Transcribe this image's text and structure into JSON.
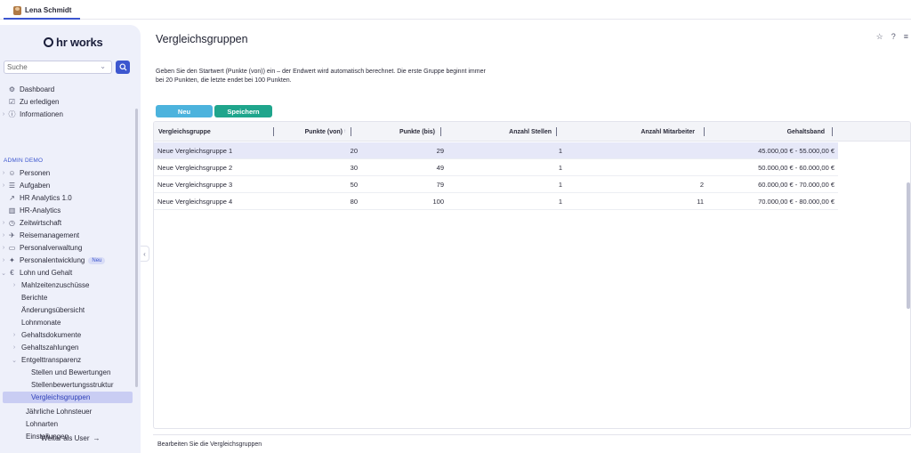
{
  "user": {
    "name": "Lena Schmidt"
  },
  "logo": {
    "text": "hr works"
  },
  "search": {
    "placeholder": "Suche"
  },
  "sidebar": {
    "top_items": [
      {
        "label": "Dashboard",
        "icon": "dashboard-icon"
      },
      {
        "label": "Zu erledigen",
        "icon": "todo-icon"
      },
      {
        "label": "Informationen",
        "icon": "info-icon"
      }
    ],
    "section_label": "ADMIN DEMO",
    "admin_items": [
      {
        "label": "Personen",
        "icon": "people-icon"
      },
      {
        "label": "Aufgaben",
        "icon": "tasks-icon"
      },
      {
        "label": "HR Analytics 1.0",
        "icon": "analytics-icon"
      },
      {
        "label": "HR-Analytics",
        "icon": "bar-chart-icon"
      },
      {
        "label": "Zeitwirtschaft",
        "icon": "clock-icon"
      },
      {
        "label": "Reisemanagement",
        "icon": "travel-icon"
      },
      {
        "label": "Personalverwaltung",
        "icon": "folder-icon"
      },
      {
        "label": "Personalentwicklung",
        "icon": "development-icon",
        "badge": "Neu"
      },
      {
        "label": "Lohn und Gehalt",
        "icon": "payroll-icon"
      }
    ],
    "payroll_items": [
      "Mahlzeitenzuschüsse",
      "Berichte",
      "Änderungsübersicht",
      "Lohnmonate",
      "Gehaltsdokumente",
      "Gehaltszahlungen",
      "Entgelttransparenz"
    ],
    "transparency_items": [
      "Stellen und Bewertungen",
      "Stellenbewertungsstruktur",
      "Vergleichsgruppen"
    ],
    "trailing_items": [
      "Jährliche Lohnsteuer",
      "Lohnarten",
      "Einstellungen"
    ],
    "weiter_label": "Weiter als User"
  },
  "page": {
    "title": "Vergleichsgruppen",
    "intro_line1": "Geben Sie den Startwert (Punkte (von)) ein – der Endwert wird automatisch berechnet. Die erste Gruppe beginnt immer",
    "intro_line2": "bei 20 Punkten, die letzte endet bei 100 Punkten.",
    "btn_new": "Neu",
    "btn_save": "Speichern",
    "footer": "Bearbeiten Sie die Vergleichsgruppen"
  },
  "table": {
    "headers": {
      "group": "Vergleichsgruppe",
      "from": "Punkte (von)",
      "to": "Punkte (bis)",
      "positions": "Anzahl Stellen",
      "employees": "Anzahl Mitarbeiter",
      "salary": "Gehaltsband"
    },
    "rows": [
      {
        "group": "Neue Vergleichsgruppe 1",
        "from": "20",
        "to": "29",
        "positions": "1",
        "employees": "",
        "salary": "45.000,00 € - 55.000,00 €"
      },
      {
        "group": "Neue Vergleichsgruppe 2",
        "from": "30",
        "to": "49",
        "positions": "1",
        "employees": "",
        "salary": "50.000,00 € - 60.000,00 €"
      },
      {
        "group": "Neue Vergleichsgruppe 3",
        "from": "50",
        "to": "79",
        "positions": "1",
        "employees": "2",
        "salary": "60.000,00 € - 70.000,00 €"
      },
      {
        "group": "Neue Vergleichsgruppe 4",
        "from": "80",
        "to": "100",
        "positions": "1",
        "employees": "11",
        "salary": "70.000,00 € - 80.000,00 €"
      }
    ]
  }
}
